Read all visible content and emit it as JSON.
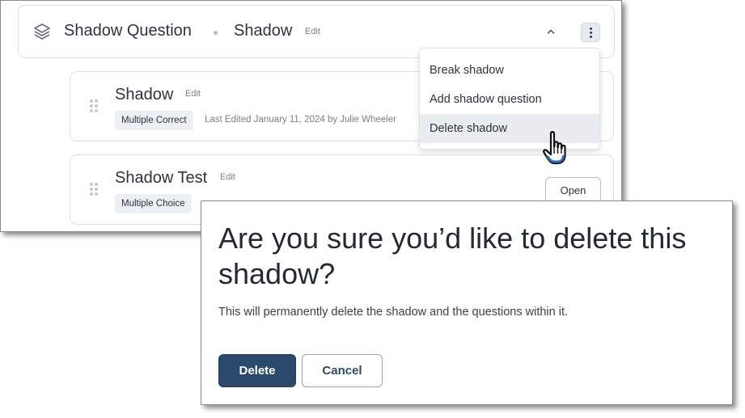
{
  "group": {
    "title": "Shadow Question",
    "subtitle": "Shadow",
    "edit_label": "Edit"
  },
  "questions": [
    {
      "title": "Shadow",
      "edit_label": "Edit",
      "type_badge": "Multiple Correct",
      "meta": "Last Edited January 11, 2024 by Julie Wheeler"
    },
    {
      "title": "Shadow Test",
      "edit_label": "Edit",
      "type_badge": "Multiple Choice",
      "open_label": "Open"
    }
  ],
  "menu": {
    "items": [
      "Break shadow",
      "Add shadow question",
      "Delete shadow"
    ],
    "highlighted": "Delete shadow"
  },
  "dialog": {
    "title": "Are you sure you’d like to delete this shadow?",
    "body": "This will permanently delete the shadow and the questions within it.",
    "delete_label": "Delete",
    "cancel_label": "Cancel"
  },
  "colors": {
    "primary": "#2b4a6b",
    "menu_highlight": "#e9edf2",
    "badge_bg": "#eceff3"
  },
  "icons": {
    "group": "layers-icon",
    "collapse": "chevron-up-icon",
    "more": "kebab-menu-icon",
    "drag": "drag-handle-icon",
    "cursor": "hand-pointer-cursor"
  }
}
